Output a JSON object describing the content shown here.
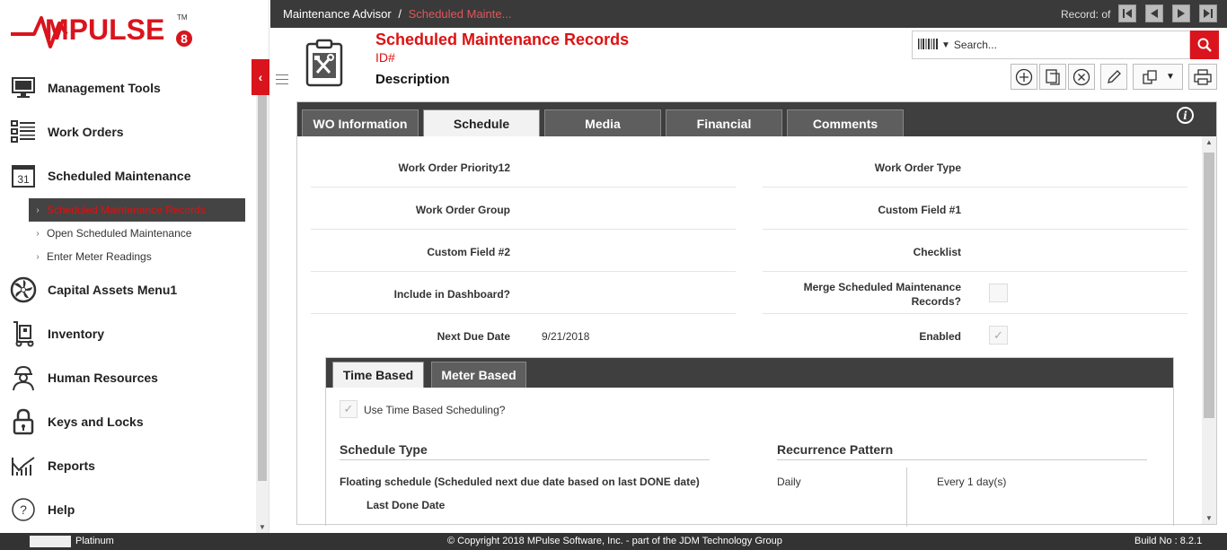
{
  "app": {
    "logo_text": "MPULSE",
    "logo_mark": "TM",
    "logo_version": "8"
  },
  "sidebar": {
    "items": [
      {
        "label": "Management Tools",
        "icon": "monitor-icon"
      },
      {
        "label": "Work Orders",
        "icon": "list-icon"
      },
      {
        "label": "Scheduled Maintenance",
        "icon": "calendar-icon",
        "icon_text": "31"
      },
      {
        "label": "Capital Assets Menu1",
        "icon": "fan-icon"
      },
      {
        "label": "Inventory",
        "icon": "dolly-icon"
      },
      {
        "label": "Human Resources",
        "icon": "worker-icon"
      },
      {
        "label": "Keys and Locks",
        "icon": "lock-icon"
      },
      {
        "label": "Reports",
        "icon": "chart-icon"
      },
      {
        "label": "Help",
        "icon": "help-icon"
      }
    ],
    "sub_items": [
      {
        "label": "Scheduled Maintenance Records",
        "active": true
      },
      {
        "label": "Open Scheduled Maintenance",
        "active": false
      },
      {
        "label": "Enter Meter Readings",
        "active": false
      }
    ]
  },
  "breadcrumb": {
    "root": "Maintenance Advisor",
    "sep": "/",
    "current": "Scheduled Mainte..."
  },
  "record": {
    "label": "Record: of"
  },
  "header": {
    "title": "Scheduled Maintenance Records",
    "id_label": "ID#",
    "desc_label": "Description"
  },
  "search": {
    "placeholder": "Search..."
  },
  "tabs": [
    "WO Information",
    "Schedule",
    "Media",
    "Financial",
    "Comments"
  ],
  "fields": {
    "wo_priority": "Work Order Priority12",
    "wo_type": "Work Order Type",
    "wo_group": "Work Order Group",
    "custom1": "Custom Field #1",
    "custom2": "Custom Field #2",
    "checklist": "Checklist",
    "include_dash": "Include in Dashboard?",
    "merge_line1": "Merge Scheduled Maintenance",
    "merge_line2": "Records?",
    "next_due_label": "Next Due Date",
    "next_due_value": "9/21/2018",
    "enabled": "Enabled"
  },
  "subtabs": [
    "Time Based",
    "Meter Based"
  ],
  "time_based": {
    "use_label": "Use Time Based Scheduling?",
    "schedule_type_title": "Schedule Type",
    "schedule_type_value": "Floating schedule (Scheduled next due date based on last DONE date)",
    "last_done_label": "Last Done Date",
    "recurrence_title": "Recurrence Pattern",
    "recurrence_value": "Daily",
    "every_value": "Every 1 day(s)"
  },
  "footer": {
    "edition": "Platinum",
    "copyright": "© Copyright 2018 MPulse Software, Inc. - part of the JDM Technology Group",
    "build": "Build No : 8.2.1"
  },
  "colors": {
    "accent": "#d9141d",
    "dark": "#3a3a3a"
  }
}
